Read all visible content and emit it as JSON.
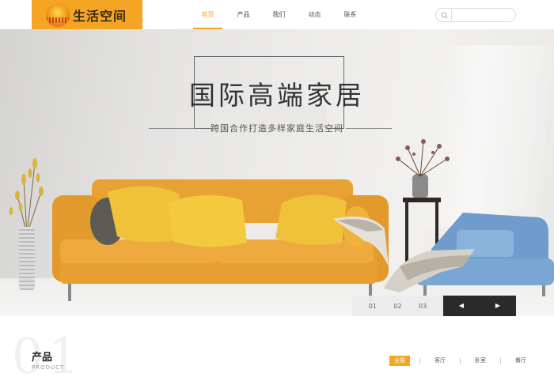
{
  "header": {
    "logo_text": "生活空间",
    "nav": [
      {
        "label": "首页",
        "active": true
      },
      {
        "label": "产品",
        "active": false
      },
      {
        "label": "我们",
        "active": false
      },
      {
        "label": "动态",
        "active": false
      },
      {
        "label": "联系",
        "active": false
      }
    ],
    "search": {
      "value": "",
      "placeholder": ""
    }
  },
  "hero": {
    "title": "国际高端家居",
    "subtitle": "跨国合作打造多样家庭生活空间",
    "slides": [
      "01",
      "02",
      "03"
    ],
    "prev_label": "◀",
    "next_label": "▶"
  },
  "products": {
    "bg_number": "01",
    "title": "产品",
    "subtitle": "PRODUCT",
    "categories": [
      {
        "label": "全部",
        "active": true
      },
      {
        "label": "客厅",
        "active": false
      },
      {
        "label": "卧室",
        "active": false
      },
      {
        "label": "餐厅",
        "active": false
      }
    ]
  },
  "colors": {
    "accent": "#f5a524",
    "dark": "#2b2b2b"
  }
}
